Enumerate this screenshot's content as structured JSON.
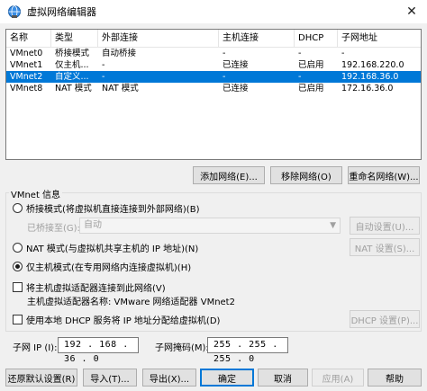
{
  "window": {
    "title": "虚拟网络编辑器",
    "close_glyph": "✕"
  },
  "table": {
    "headers": [
      "名称",
      "类型",
      "外部连接",
      "主机连接",
      "DHCP",
      "子网地址"
    ],
    "rows": [
      [
        "VMnet0",
        "桥接模式",
        "自动桥接",
        "-",
        "-",
        "-"
      ],
      [
        "VMnet1",
        "仅主机...",
        "-",
        "已连接",
        "已启用",
        "192.168.220.0"
      ],
      [
        "VMnet2",
        "自定义...",
        "-",
        "-",
        "-",
        "192.168.36.0"
      ],
      [
        "VMnet8",
        "NAT 模式",
        "NAT 模式",
        "已连接",
        "已启用",
        "172.16.36.0"
      ]
    ],
    "selected_index": 2
  },
  "list_buttons": {
    "add": "添加网络(E)...",
    "remove": "移除网络(O)",
    "rename": "重命名网络(W)..."
  },
  "vmnet_info": {
    "group_label": "VMnet 信息",
    "bridge_radio": "桥接模式(将虚拟机直接连接到外部网络)(B)",
    "bridged_to_label": "已桥接至(G):",
    "bridged_to_value": "自动",
    "auto_settings": "自动设置(U)...",
    "nat_radio": "NAT 模式(与虚拟机共享主机的 IP 地址)(N)",
    "nat_settings": "NAT 设置(S)...",
    "hostonly_radio": "仅主机模式(在专用网络内连接虚拟机)(H)",
    "selected_mode": "hostonly",
    "connect_adapter_check": "将主机虚拟适配器连接到此网络(V)",
    "adapter_name_text": "主机虚拟适配器名称: VMware 网络适配器 VMnet2",
    "dhcp_check": "使用本地 DHCP 服务将 IP 地址分配给虚拟机(D)",
    "dhcp_settings": "DHCP 设置(P)...",
    "subnet_ip_label": "子网 IP (I):",
    "subnet_ip_value": "192 . 168 . 36 . 0",
    "subnet_mask_label": "子网掩码(M):",
    "subnet_mask_value": "255 . 255 . 255 . 0"
  },
  "bottom_buttons": {
    "restore": "还原默认设置(R)",
    "import": "导入(T)...",
    "export": "导出(X)...",
    "ok": "确定",
    "cancel": "取消",
    "apply": "应用(A)",
    "help": "帮助"
  },
  "colors": {
    "selection": "#0078d7",
    "accent": "#0078d7"
  }
}
